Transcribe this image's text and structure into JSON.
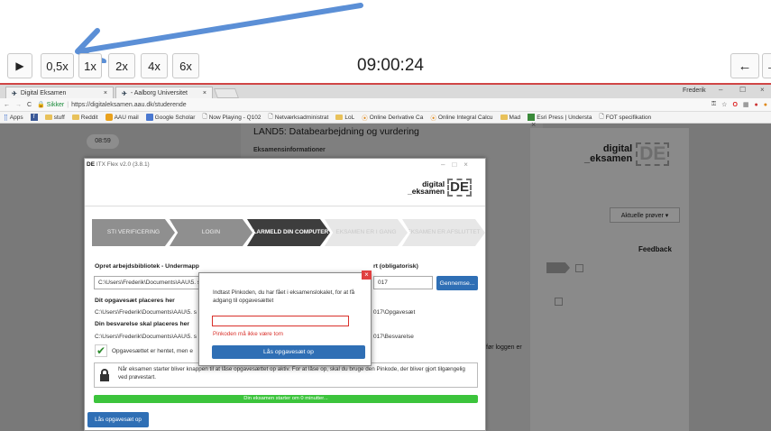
{
  "player": {
    "play_label": "▶",
    "speeds": [
      "0,5x",
      "1x",
      "2x",
      "4x",
      "6x"
    ],
    "clock": "09:00:24",
    "back_label": "←",
    "forward_label": "→"
  },
  "browser": {
    "tabs": [
      "Digital Eksamen",
      "- Aalborg Universitet"
    ],
    "profile": "Frederik",
    "secure_label": "Sikker",
    "url": "https://digitaleksamen.aau.dk/studerende",
    "bookmarks": [
      "Apps",
      "stuff",
      "Reddit",
      "AAU mail",
      "Google Scholar",
      "Now Playing - Q102",
      "Netværksadministrat",
      "LoL",
      "Online Derivative Ca",
      "Online Integral Calcu",
      "Mad",
      "Esri Press | Understa",
      "FOT specifikation"
    ]
  },
  "background": {
    "timer": "08:59",
    "exam_title": "LAND5: Databearbejdning og vurdering",
    "exam_info_heading": "Eksamensinformationer",
    "logo_line1": "digital",
    "logo_line2": "_eksamen",
    "logo_mark": "DE",
    "dropdown": "Aktuelle prøver ▾",
    "feedback": "Feedback",
    "log_text": "før loggen er"
  },
  "app": {
    "title": "ITX Flex v2.0 (3.8.1)",
    "logo_line1": "digital",
    "logo_line2": "_eksamen",
    "logo_mark": "DE",
    "steps": [
      "STI VERIFICERING",
      "LOGIN",
      "KLARMELD DIN COMPUTER",
      "EKSAMEN ER I GANG",
      "EKSAMEN ER AFSLUTTET"
    ],
    "workdir_label": "Opret arbejdsbibliotek - Undermapp",
    "workdir_value": "C:\\Users\\Frederik\\Documents\\AAU\\5. s",
    "required_label": "rt (obligatorisk)",
    "required_value": "017",
    "browse_button": "Gennemse...",
    "assignment_label": "Dit opgavesæt placeres her",
    "assignment_path": "C:\\Users\\Frederik\\Documents\\AAU\\5. s",
    "assignment_path_tail": "017\\Opgavesæt",
    "answer_label": "Din besvarelse skal placeres her",
    "answer_path": "C:\\Users\\Frederik\\Documents\\AAU\\5. s",
    "answer_path_tail": "017\\Besvarelse",
    "fetched_text": "Opgavesættet er hentet, men e",
    "notice": "Når eksamen starter bliver knappen til at låse opgavesættet op aktiv. For at låse op, skal du bruge den Pinkode, der bliver gjort tilgængelig ved prøvestart.",
    "progress_text": "Din eksamen starter om 0 minutter...",
    "unlock_button": "Lås opgavesæt op"
  },
  "dialog": {
    "prompt": "Indtast Pinkoden, du har fået i eksamenslokalet, for at få adgang til opgavesættet",
    "pin_value": "",
    "error": "Pinkoden må ikke være tom",
    "button": "Lås opgavesæt op"
  },
  "colors": {
    "arrow": "#5b8fd6",
    "error": "#d9312b",
    "primary": "#2f6fb5",
    "progress": "#3cc43c"
  }
}
